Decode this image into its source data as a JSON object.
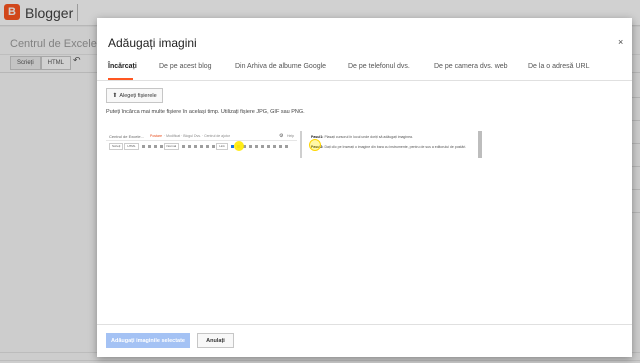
{
  "app": {
    "brand": "Blogger",
    "logo_letter": "B"
  },
  "editor": {
    "post_title_placeholder": "Centrul de Excele...",
    "mode_compose": "Scrieți",
    "mode_html": "HTML",
    "undo_glyph": "↶"
  },
  "dialog": {
    "title": "Adăugați imagini",
    "close_glyph": "×",
    "tabs": [
      {
        "label": "Încărcați",
        "active": true
      },
      {
        "label": "De pe acest blog"
      },
      {
        "label": "Din Arhiva de albume Google"
      },
      {
        "label": "De pe telefonul dvs."
      },
      {
        "label": "De pe camera dvs. web"
      },
      {
        "label": "De la o adresă URL"
      }
    ],
    "upload_button": "Alegeți fișierele",
    "upload_icon_glyph": "⬆",
    "hint": "Puteți încărca mai multe fișiere în același timp. Utilizați fișiere JPG, GIF sau PNG.",
    "add_button": "Adăugați imaginile selectate",
    "cancel_button": "Anulați"
  },
  "preview": {
    "post_title": "Centrul de Excele...",
    "breadcrumb_blog": "Postare",
    "breadcrumb_rest": "· Modificat · Blogul Dvs. · Centrul de ajutor",
    "gear_glyph": "⚙",
    "help_text": "Help",
    "mode_compose": "Scrieți",
    "mode_html": "HTML",
    "font_label": "Normal",
    "link_label": "Link",
    "step1_label": "Pasul1:",
    "step1_text": "Plasați cursorul în locul unde doriți să adăugați imaginea.",
    "step2_label": "Pasul2:",
    "step2_text": "Dați clic pe Inserați o imagine din bara cu instrumente, pentru de sus a editorului de postări."
  },
  "colors": {
    "accent": "#ff5722",
    "primary_disabled": "#a4c2f4",
    "highlight": "#ffea00"
  }
}
